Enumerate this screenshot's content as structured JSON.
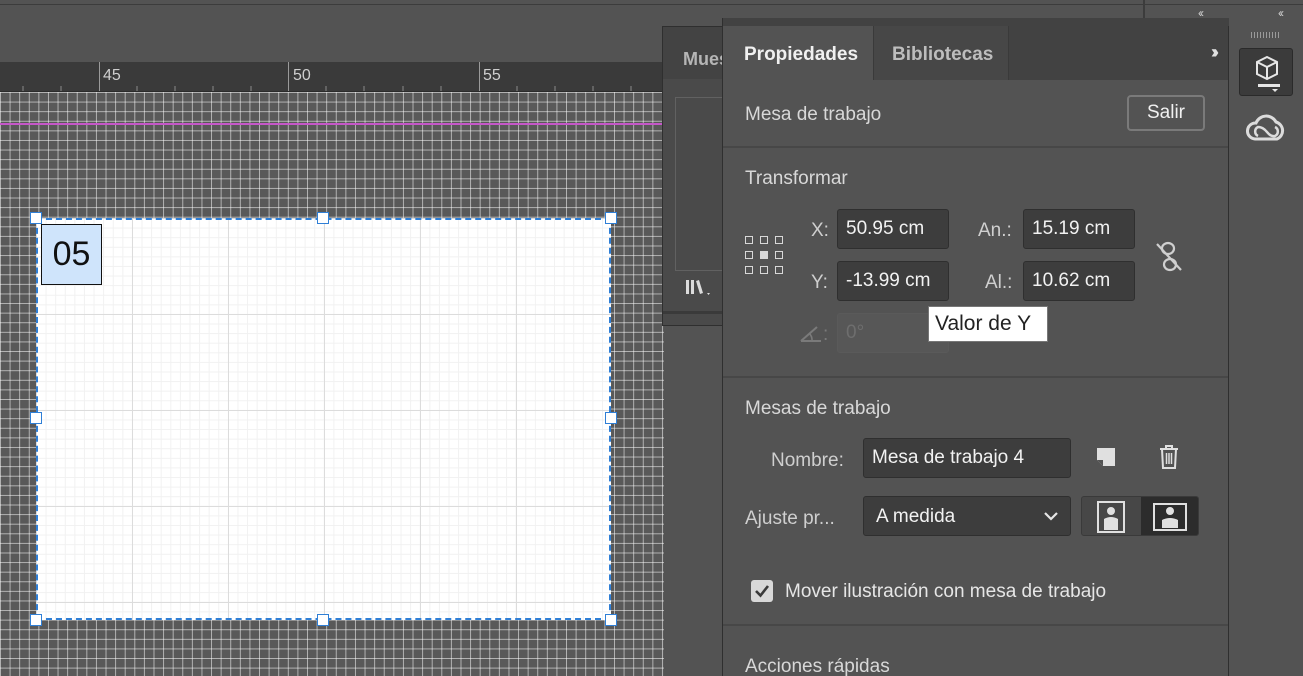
{
  "ruler": {
    "labels": [
      "45",
      "50",
      "55"
    ]
  },
  "canvas": {
    "artboard_label": "05"
  },
  "swatches_panel": {
    "tab_label": "Muestras"
  },
  "properties": {
    "tabs": [
      {
        "label": "Propiedades",
        "active": true
      },
      {
        "label": "Bibliotecas",
        "active": false
      }
    ],
    "context": {
      "title": "Mesa de trabajo",
      "exit_button": "Salir"
    },
    "transform": {
      "title": "Transformar",
      "x_label": "X:",
      "x_value": "50.95 cm",
      "y_label": "Y:",
      "y_value": "-13.99 cm",
      "w_label": "An.:",
      "w_value": "15.19 cm",
      "h_label": "Al.:",
      "h_value": "10.62 cm",
      "angle_label": ":",
      "angle_value": "0°",
      "constrain_icon": "unlink-icon",
      "tooltip": "Valor de Y"
    },
    "artboards": {
      "title": "Mesas de trabajo",
      "name_label": "Nombre:",
      "name_value": "Mesa de trabajo 4",
      "preset_label": "Ajuste pr...",
      "preset_value": "A medida",
      "move_with_artboard_label": "Mover ilustración con mesa de trabajo",
      "move_with_artboard_checked": true
    },
    "quick_actions": {
      "title": "Acciones rápidas"
    }
  },
  "colors": {
    "accent": "#2f7fd6",
    "guide": "#c557c9",
    "panel_bg": "#535353",
    "field_bg": "#3d3d3d"
  }
}
